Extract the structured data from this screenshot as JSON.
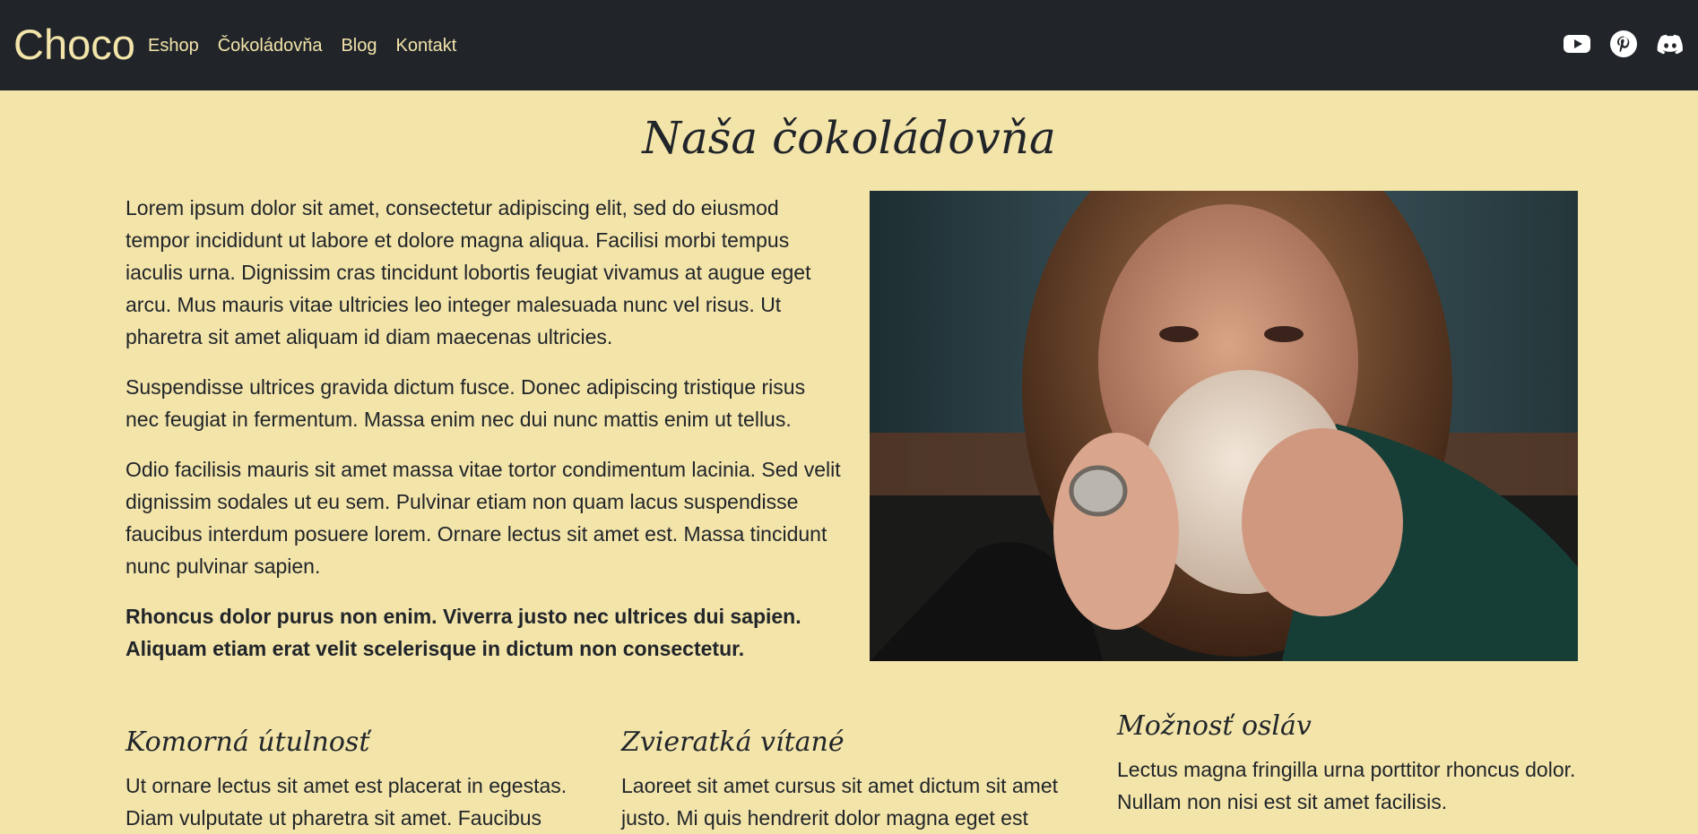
{
  "navbar": {
    "brand": "Choco",
    "links": [
      "Eshop",
      "Čokoládovňa",
      "Blog",
      "Kontakt"
    ],
    "socials": [
      "youtube-icon",
      "pinterest-icon",
      "discord-icon"
    ],
    "background": "#212529",
    "link_color": "#f3e4aa"
  },
  "page": {
    "background": "#f3e4aa",
    "title": "Naša čokoládovňa"
  },
  "intro": {
    "paragraphs": [
      "Lorem ipsum dolor sit amet, consectetur adipiscing elit, sed do eiusmod tempor incididunt ut labore et dolore magna aliqua. Facilisi morbi tempus iaculis urna. Dignissim cras tincidunt lobortis feugiat vivamus at augue eget arcu. Mus mauris vitae ultricies leo integer malesuada nunc vel risus. Ut pharetra sit amet aliquam id diam maecenas ultricies.",
      "Suspendisse ultrices gravida dictum fusce. Donec adipiscing tristique risus nec feugiat in fermentum. Massa enim nec dui nunc mattis enim ut tellus.",
      "Odio facilisis mauris sit amet massa vitae tortor condimentum lacinia. Sed velit dignissim sodales ut eu sem. Pulvinar etiam non quam lacus suspendisse faucibus interdum posuere lorem. Ornare lectus sit amet est. Massa tincidunt nunc pulvinar sapien."
    ],
    "bold_paragraph": "Rhoncus dolor purus non enim. Viverra justo nec ultrices dui sapien. Aliquam etiam erat velit scelerisque in dictum non consectetur."
  },
  "features": [
    {
      "title": "Komorná útulnosť",
      "text": "Ut ornare lectus sit amet est placerat in egestas. Diam vulputate ut pharetra sit amet. Faucibus"
    },
    {
      "title": "Zvieratká vítané",
      "text": "Laoreet sit amet cursus sit amet dictum sit amet justo. Mi quis hendrerit dolor magna eget est"
    },
    {
      "title": "Možnosť osláv",
      "text": "Lectus magna fringilla urna porttitor rhoncus dolor. Nullam non nisi est sit amet facilisis."
    }
  ]
}
